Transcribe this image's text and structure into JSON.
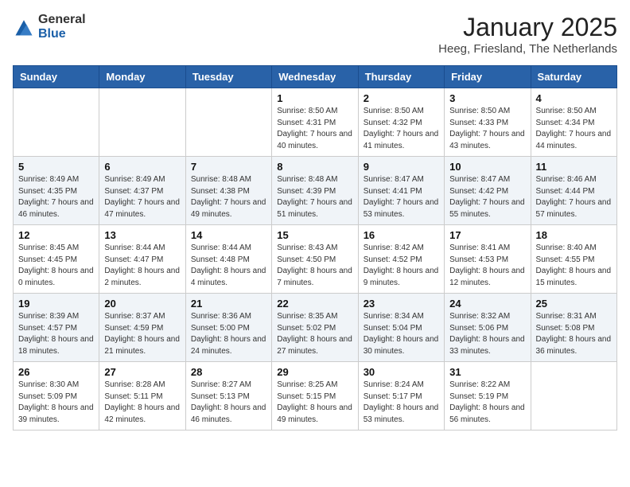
{
  "header": {
    "logo_general": "General",
    "logo_blue": "Blue",
    "month_year": "January 2025",
    "location": "Heeg, Friesland, The Netherlands"
  },
  "weekdays": [
    "Sunday",
    "Monday",
    "Tuesday",
    "Wednesday",
    "Thursday",
    "Friday",
    "Saturday"
  ],
  "weeks": [
    [
      {
        "day": "",
        "info": ""
      },
      {
        "day": "",
        "info": ""
      },
      {
        "day": "",
        "info": ""
      },
      {
        "day": "1",
        "info": "Sunrise: 8:50 AM\nSunset: 4:31 PM\nDaylight: 7 hours\nand 40 minutes."
      },
      {
        "day": "2",
        "info": "Sunrise: 8:50 AM\nSunset: 4:32 PM\nDaylight: 7 hours\nand 41 minutes."
      },
      {
        "day": "3",
        "info": "Sunrise: 8:50 AM\nSunset: 4:33 PM\nDaylight: 7 hours\nand 43 minutes."
      },
      {
        "day": "4",
        "info": "Sunrise: 8:50 AM\nSunset: 4:34 PM\nDaylight: 7 hours\nand 44 minutes."
      }
    ],
    [
      {
        "day": "5",
        "info": "Sunrise: 8:49 AM\nSunset: 4:35 PM\nDaylight: 7 hours\nand 46 minutes."
      },
      {
        "day": "6",
        "info": "Sunrise: 8:49 AM\nSunset: 4:37 PM\nDaylight: 7 hours\nand 47 minutes."
      },
      {
        "day": "7",
        "info": "Sunrise: 8:48 AM\nSunset: 4:38 PM\nDaylight: 7 hours\nand 49 minutes."
      },
      {
        "day": "8",
        "info": "Sunrise: 8:48 AM\nSunset: 4:39 PM\nDaylight: 7 hours\nand 51 minutes."
      },
      {
        "day": "9",
        "info": "Sunrise: 8:47 AM\nSunset: 4:41 PM\nDaylight: 7 hours\nand 53 minutes."
      },
      {
        "day": "10",
        "info": "Sunrise: 8:47 AM\nSunset: 4:42 PM\nDaylight: 7 hours\nand 55 minutes."
      },
      {
        "day": "11",
        "info": "Sunrise: 8:46 AM\nSunset: 4:44 PM\nDaylight: 7 hours\nand 57 minutes."
      }
    ],
    [
      {
        "day": "12",
        "info": "Sunrise: 8:45 AM\nSunset: 4:45 PM\nDaylight: 8 hours\nand 0 minutes."
      },
      {
        "day": "13",
        "info": "Sunrise: 8:44 AM\nSunset: 4:47 PM\nDaylight: 8 hours\nand 2 minutes."
      },
      {
        "day": "14",
        "info": "Sunrise: 8:44 AM\nSunset: 4:48 PM\nDaylight: 8 hours\nand 4 minutes."
      },
      {
        "day": "15",
        "info": "Sunrise: 8:43 AM\nSunset: 4:50 PM\nDaylight: 8 hours\nand 7 minutes."
      },
      {
        "day": "16",
        "info": "Sunrise: 8:42 AM\nSunset: 4:52 PM\nDaylight: 8 hours\nand 9 minutes."
      },
      {
        "day": "17",
        "info": "Sunrise: 8:41 AM\nSunset: 4:53 PM\nDaylight: 8 hours\nand 12 minutes."
      },
      {
        "day": "18",
        "info": "Sunrise: 8:40 AM\nSunset: 4:55 PM\nDaylight: 8 hours\nand 15 minutes."
      }
    ],
    [
      {
        "day": "19",
        "info": "Sunrise: 8:39 AM\nSunset: 4:57 PM\nDaylight: 8 hours\nand 18 minutes."
      },
      {
        "day": "20",
        "info": "Sunrise: 8:37 AM\nSunset: 4:59 PM\nDaylight: 8 hours\nand 21 minutes."
      },
      {
        "day": "21",
        "info": "Sunrise: 8:36 AM\nSunset: 5:00 PM\nDaylight: 8 hours\nand 24 minutes."
      },
      {
        "day": "22",
        "info": "Sunrise: 8:35 AM\nSunset: 5:02 PM\nDaylight: 8 hours\nand 27 minutes."
      },
      {
        "day": "23",
        "info": "Sunrise: 8:34 AM\nSunset: 5:04 PM\nDaylight: 8 hours\nand 30 minutes."
      },
      {
        "day": "24",
        "info": "Sunrise: 8:32 AM\nSunset: 5:06 PM\nDaylight: 8 hours\nand 33 minutes."
      },
      {
        "day": "25",
        "info": "Sunrise: 8:31 AM\nSunset: 5:08 PM\nDaylight: 8 hours\nand 36 minutes."
      }
    ],
    [
      {
        "day": "26",
        "info": "Sunrise: 8:30 AM\nSunset: 5:09 PM\nDaylight: 8 hours\nand 39 minutes."
      },
      {
        "day": "27",
        "info": "Sunrise: 8:28 AM\nSunset: 5:11 PM\nDaylight: 8 hours\nand 42 minutes."
      },
      {
        "day": "28",
        "info": "Sunrise: 8:27 AM\nSunset: 5:13 PM\nDaylight: 8 hours\nand 46 minutes."
      },
      {
        "day": "29",
        "info": "Sunrise: 8:25 AM\nSunset: 5:15 PM\nDaylight: 8 hours\nand 49 minutes."
      },
      {
        "day": "30",
        "info": "Sunrise: 8:24 AM\nSunset: 5:17 PM\nDaylight: 8 hours\nand 53 minutes."
      },
      {
        "day": "31",
        "info": "Sunrise: 8:22 AM\nSunset: 5:19 PM\nDaylight: 8 hours\nand 56 minutes."
      },
      {
        "day": "",
        "info": ""
      }
    ]
  ]
}
